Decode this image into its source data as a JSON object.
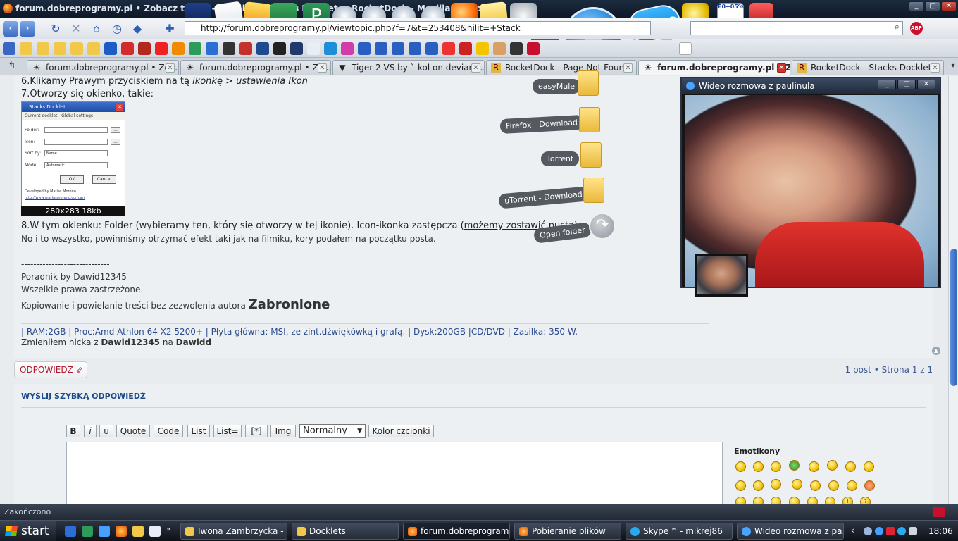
{
  "window": {
    "title": "forum.dobreprogramy.pl • Zobacz temat - Instalacja Stacks Docklet w RocketDock - Mozilla Firefox"
  },
  "nav": {
    "url": "http://forum.dobreprogramy.pl/viewtopic.php?f=7&t=253408&hilit=+Stack",
    "search_placeholder": "",
    "abp_label": "ABP"
  },
  "tabs": [
    {
      "label": "forum.dobreprogramy.pl • Zo...",
      "active": false
    },
    {
      "label": "forum.dobreprogramy.pl • Zo...",
      "active": false
    },
    {
      "label": "Tiger 2 VS by `-kol on deviant...",
      "active": false
    },
    {
      "label": "RocketDock - Page Not Found",
      "active": false
    },
    {
      "label": "forum.dobreprogramy.pl • Z...",
      "active": true
    },
    {
      "label": "RocketDock - Stacks Docklet",
      "active": false
    }
  ],
  "post": {
    "step6_prefix": "6.Klikamy Prawym przyciskiem na tą ",
    "step6_em": "ikonkę > ustawienia Ikon",
    "step7": "7.Otworzy się okienko, takie:",
    "thumb": {
      "title": "Stacks Docklet",
      "tab1": "Current docklet",
      "tab2": "Global settings",
      "folder_label": "Folder:",
      "icon_label": "Icon:",
      "sortby_label": "Sort by:",
      "sortby_value": "Name",
      "mode_label": "Mode:",
      "mode_value": "Automatic",
      "ok": "OK",
      "cancel": "Cancel",
      "dev": "Developed by Matias Moreno",
      "devlink": "http://www.matiasmoreno.com.ar/",
      "caption": "280x283 18kb"
    },
    "step8_prefix": "8.W tym okienku: Folder (wybieramy ten, który się otworzy w tej ikonie). Icon-ikonka zastępcza (",
    "step8_link": "możemy zostawić pusta",
    "step8_suffix": ")",
    "line_done": "No i to wszystko, powinniśmy otrzymać efekt taki jak na filmiku, kory podałem na początku posta.",
    "separator": "-----------------------------",
    "author": "Poradnik by Dawid12345",
    "rights": "Wszelkie prawa zastrzeżone.",
    "copy_prefix": "Kopiowanie i powielanie treści bez zezwolenia autora ",
    "copy_big": "Zabronione",
    "sig_specs": "| RAM:2GB | Proc:Amd Athlon 64 X2 5200+ | Płyta główna: MSI, ze zint.dźwiękówką i grafą. | Dysk:200GB |CD/DVD | Zasilka: 350 W.",
    "sig_nick_prefix": "Zmieniłem nicka z ",
    "sig_nick_old": "Dawid12345",
    "sig_nick_mid": " na ",
    "sig_nick_new": "Dawidd"
  },
  "reply": {
    "button": "ODPOWIEDZ",
    "pager": "1 post • Strona 1 z 1"
  },
  "quick": {
    "title": "WYŚLIJ SZYBKĄ ODPOWIEDŹ",
    "buttons": [
      "B",
      "i",
      "u",
      "Quote",
      "Code",
      "List",
      "List=",
      "[*]",
      "Img"
    ],
    "size_value": "Normalny",
    "color_button": "Kolor czcionki",
    "emoticons_title": "Emotikony"
  },
  "stack": {
    "items": [
      "easyMule",
      "Firefox - Download",
      "Torrent",
      "uTorrent - Download"
    ],
    "open_folder": "Open folder"
  },
  "video": {
    "title": "Wideo rozmowa z paulinula"
  },
  "status": {
    "text": "Zakończono"
  },
  "taskbar": {
    "start": "start",
    "tasks": [
      "Iwona Zambrzycka - ...",
      "Docklets",
      "forum.dobreprogram...",
      "Pobieranie plików",
      "Skype™ - mikrej86",
      "Wideo rozmowa z pa..."
    ],
    "clock": "18:06"
  },
  "dock_labels": {
    "skype": "skype",
    "percent": "E0+05%"
  },
  "colors": {
    "accent_link": "#1d4a87",
    "reply_red": "#b0182b",
    "active_tab_close": "#d0342c"
  }
}
